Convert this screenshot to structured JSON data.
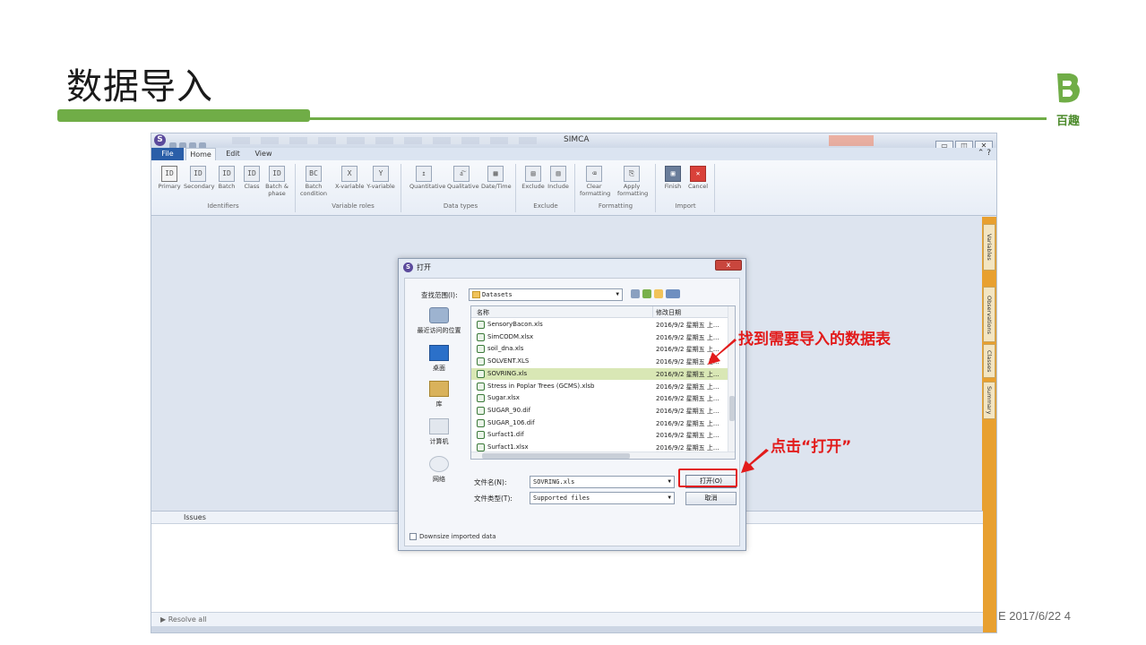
{
  "slide": {
    "title": "数据导入",
    "logo_text": "百趣",
    "footer": "E 2017/6/22 4",
    "accent_color": "#70ad47"
  },
  "app": {
    "title": "SIMCA",
    "tabs": [
      "File",
      "Home",
      "Edit",
      "View"
    ],
    "help": "?",
    "ribbon": {
      "identifiers": {
        "group": "Identifiers",
        "buttons": [
          {
            "label": "Primary",
            "icon": "ID"
          },
          {
            "label": "Secondary",
            "icon": "ID"
          },
          {
            "label": "Batch",
            "icon": "ID"
          },
          {
            "label": "Class",
            "icon": "ID"
          },
          {
            "label": "Batch &\nphase",
            "icon": "ID"
          }
        ]
      },
      "variable_roles": {
        "group": "Variable roles",
        "buttons": [
          {
            "label": "Batch\ncondition",
            "icon": "BC"
          },
          {
            "label": "X-variable",
            "icon": "X"
          },
          {
            "label": "Y-variable",
            "icon": "Y"
          }
        ]
      },
      "data_types": {
        "group": "Data types",
        "buttons": [
          {
            "label": "Quantitative"
          },
          {
            "label": "Qualitative"
          },
          {
            "label": "Date/Time"
          }
        ]
      },
      "exclude": {
        "group": "Exclude",
        "buttons": [
          {
            "label": "Exclude"
          },
          {
            "label": "Include"
          }
        ]
      },
      "formatting": {
        "group": "Formatting",
        "buttons": [
          {
            "label": "Clear\nformatting"
          },
          {
            "label": "Apply\nformatting"
          }
        ]
      },
      "import": {
        "group": "Import",
        "buttons": [
          {
            "label": "Finish"
          },
          {
            "label": "Cancel"
          }
        ]
      }
    },
    "dock_tabs": [
      "Variables",
      "Observations",
      "Classes",
      "Summary"
    ],
    "issues_label": "Issues",
    "resolve_label": "▶ Resolve all"
  },
  "dialog": {
    "title": "打开",
    "close": "x",
    "lookin_label": "查找范围(I):",
    "lookin_value": "Datasets",
    "places": [
      "最近访问的位置",
      "桌面",
      "库",
      "计算机",
      "网络"
    ],
    "columns": {
      "name": "名称",
      "date": "修改日期"
    },
    "files": [
      {
        "name": "SensoryBacon.xls",
        "date": "2016/9/2 星期五 上..."
      },
      {
        "name": "SimCODM.xlsx",
        "date": "2016/9/2 星期五 上..."
      },
      {
        "name": "soil_dna.xls",
        "date": "2016/9/2 星期五 上..."
      },
      {
        "name": "SOLVENT.XLS",
        "date": "2016/9/2 星期五 上..."
      },
      {
        "name": "SOVRING.xls",
        "date": "2016/9/2 星期五 上...",
        "selected": true
      },
      {
        "name": "Stress in Poplar Trees (GCMS).xlsb",
        "date": "2016/9/2 星期五 上..."
      },
      {
        "name": "Sugar.xlsx",
        "date": "2016/9/2 星期五 上..."
      },
      {
        "name": "SUGAR_90.dif",
        "date": "2016/9/2 星期五 上..."
      },
      {
        "name": "SUGAR_106.dif",
        "date": "2016/9/2 星期五 上..."
      },
      {
        "name": "Surfact1.dif",
        "date": "2016/9/2 星期五 上..."
      },
      {
        "name": "Surfact1.xlsx",
        "date": "2016/9/2 星期五 上..."
      },
      {
        "name": "Surfact2.dif",
        "date": "2016/9/2 星期五 上..."
      }
    ],
    "filename_label": "文件名(N):",
    "filename_value": "SOVRING.xls",
    "filetype_label": "文件类型(T):",
    "filetype_value": "Supported files",
    "open_button": "打开(O)",
    "cancel_button": "取消",
    "downsize_label": "Downsize imported data"
  },
  "annotations": {
    "find_table": "找到需要导入的数据表",
    "click_open": "点击“打开”",
    "color": "#e21b1b"
  }
}
